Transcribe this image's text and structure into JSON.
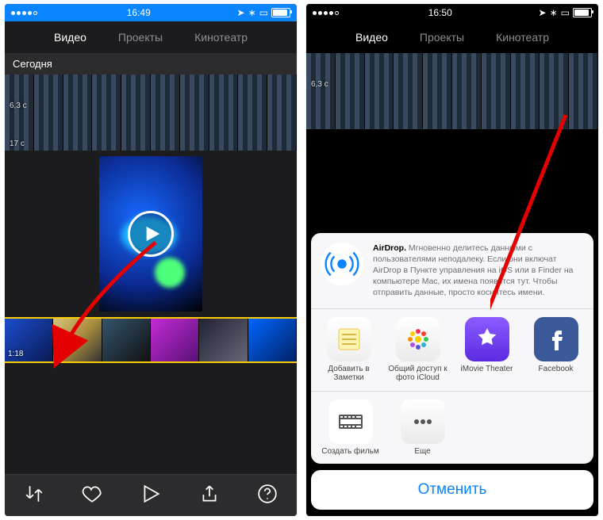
{
  "status": {
    "left_time": "16:49",
    "right_time": "16:50",
    "carrier_glyph": "",
    "icons": {
      "loc": "➤",
      "bt": "⚑",
      "cast": "▭"
    }
  },
  "tabs": {
    "video": "Видео",
    "projects": "Проекты",
    "theater": "Кинотеатр"
  },
  "left": {
    "section": "Сегодня",
    "clip1_dur": "6,3 с",
    "clip2_dur": "17 с",
    "timeline_dur": "1:18"
  },
  "right": {
    "airdrop_bold": "AirDrop.",
    "airdrop_text": " Мгновенно делитесь данными с пользователями неподалеку. Если они включат AirDrop в Пункте управления на iOS или в Finder на компьютере Mac, их имена появятся тут. Чтобы отправить данные, просто коснитесь имени.",
    "apps_row1": {
      "notes": "Добавить в Заметки",
      "icloud": "Общий доступ к фото iCloud",
      "imovie": "iMovie Theater",
      "facebook": "Facebook"
    },
    "apps_row2": {
      "film": "Создать фильм",
      "more": "Еще"
    },
    "cancel": "Отменить"
  }
}
